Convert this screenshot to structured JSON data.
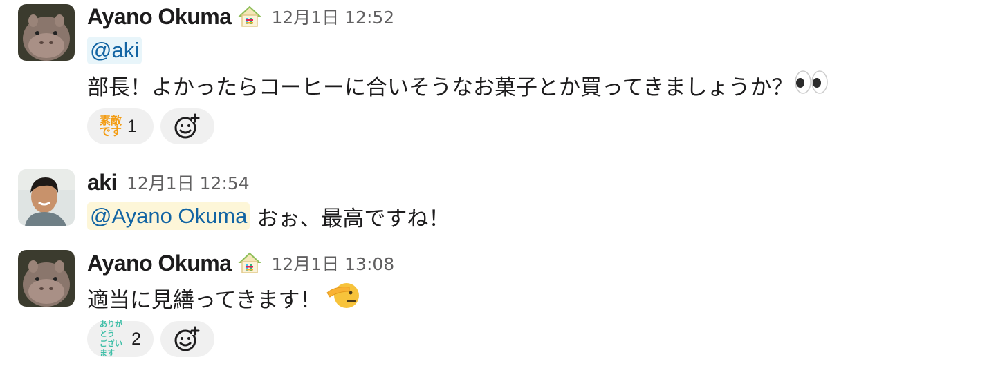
{
  "messages": [
    {
      "author": "Ayano Okuma",
      "time": "12月1日 12:52",
      "mention": "@aki",
      "text": "部長！よかったらコーヒーに合いそうなお菓子とか買ってきましょうか？",
      "trailing_emoji": "eyes-emoji",
      "reactions": [
        {
          "emoji_text_top": "素敵",
          "emoji_text_bottom": "です",
          "count": "1"
        }
      ]
    },
    {
      "author": "aki",
      "time": "12月1日 12:54",
      "mention": "@Ayano Okuma",
      "text": "おぉ、最高ですね！"
    },
    {
      "author": "Ayano Okuma",
      "time": "12月1日 13:08",
      "text": "適当に見繕ってきます！",
      "trailing_emoji": "saluting-face-emoji",
      "reactions": [
        {
          "emoji_text_top": "ありがとう",
          "emoji_text_bottom": "ございます",
          "count": "2"
        }
      ]
    }
  ],
  "colors": {
    "mention": "#1264a3",
    "mention_bg": "#e8f5fa",
    "mention_me_bg": "#fdf6d8",
    "time": "#616061",
    "reaction_bg": "#f0f0f0"
  }
}
